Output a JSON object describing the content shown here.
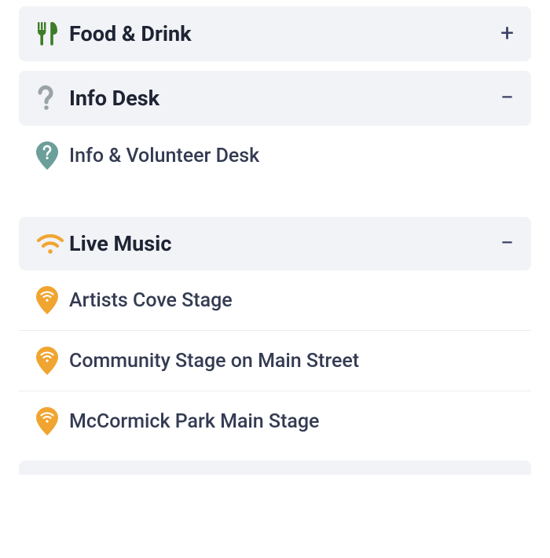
{
  "sections": [
    {
      "id": "food-drink",
      "icon": "utensils",
      "icon_color": "#3e7d27",
      "title": "Food & Drink",
      "expanded": false,
      "items": []
    },
    {
      "id": "info-desk",
      "icon": "question",
      "icon_color": "#9aa3a6",
      "title": "Info Desk",
      "expanded": true,
      "pin_color": "#6c9e9a",
      "pin_glyph": "question",
      "items": [
        {
          "label": "Info & Volunteer Desk"
        }
      ]
    },
    {
      "id": "live-music",
      "icon": "wifi",
      "icon_color": "#f0a531",
      "title": "Live Music",
      "expanded": true,
      "pin_color": "#f0a531",
      "pin_glyph": "wifi",
      "items": [
        {
          "label": "Artists Cove Stage"
        },
        {
          "label": "Community Stage on Main Street"
        },
        {
          "label": "McCormick Park Main Stage"
        }
      ]
    }
  ],
  "glyphs": {
    "plus": "+",
    "minus": "−"
  }
}
